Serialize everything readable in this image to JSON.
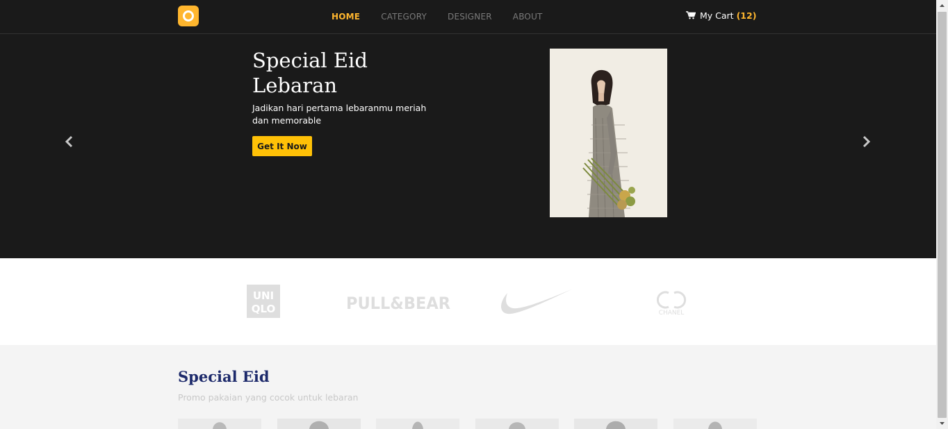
{
  "nav": {
    "links": [
      "HOME",
      "CATEGORY",
      "DESIGNER",
      "ABOUT"
    ],
    "active_index": 0,
    "cart_label": "My Cart",
    "cart_count": "(12)"
  },
  "hero": {
    "title": "Special Eid Lebaran",
    "subtitle": "Jadikan hari pertama lebaranmu meriah dan memorable",
    "cta": "Get It Now"
  },
  "brands": {
    "uniqlo": [
      "UNI",
      "QLO"
    ],
    "pullbear": "PULL&BEAR",
    "chanel": "CHANEL"
  },
  "section": {
    "title": "Special Eid",
    "subtitle": "Promo pakaian yang cocok untuk lebaran"
  },
  "colors": {
    "accent": "#ffb62e",
    "button": "#ffc107",
    "dark": "#1a1a1a",
    "section_title": "#1d2a6b"
  },
  "icons": [
    "logo-icon",
    "cart-icon",
    "chevron-left-icon",
    "chevron-right-icon",
    "nike-swoosh-icon",
    "chanel-cc-icon"
  ]
}
